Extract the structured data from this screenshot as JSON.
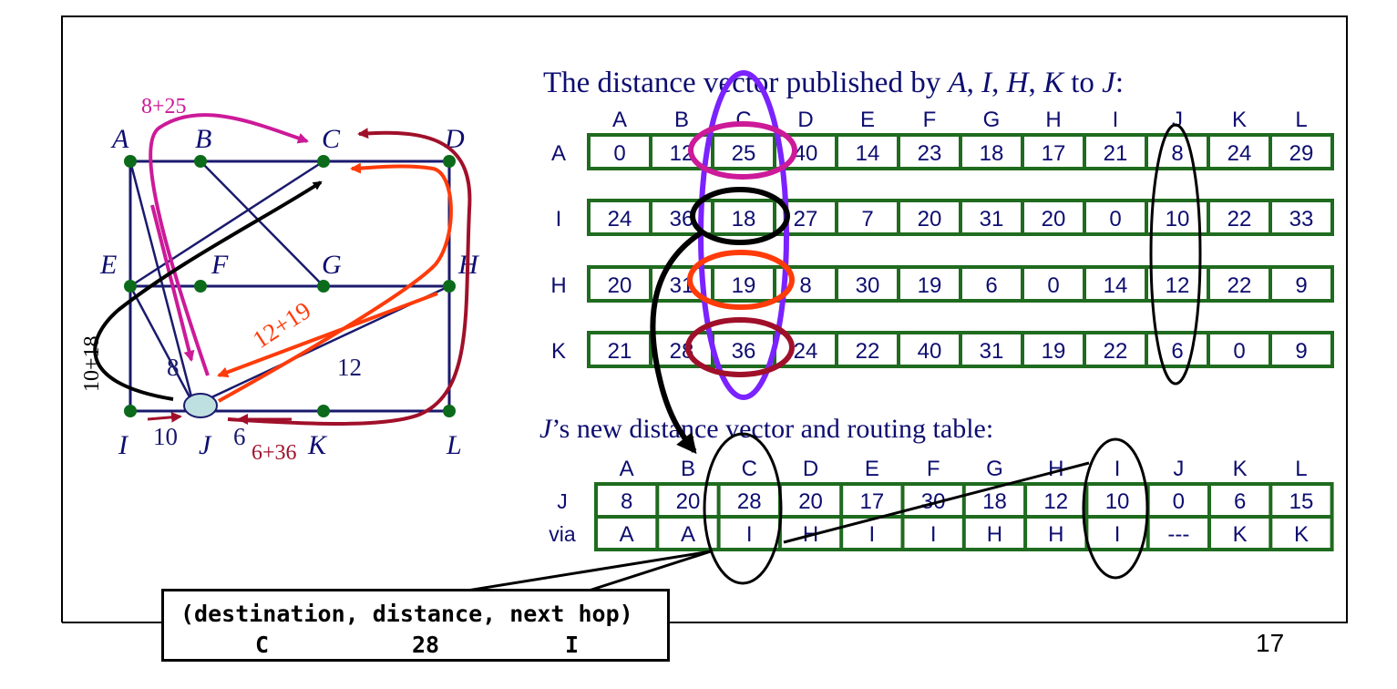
{
  "graph": {
    "nodes": [
      {
        "id": "A",
        "label": "A"
      },
      {
        "id": "B",
        "label": "B"
      },
      {
        "id": "C",
        "label": "C"
      },
      {
        "id": "D",
        "label": "D"
      },
      {
        "id": "E",
        "label": "E"
      },
      {
        "id": "F",
        "label": "F"
      },
      {
        "id": "G",
        "label": "G"
      },
      {
        "id": "H",
        "label": "H"
      },
      {
        "id": "I",
        "label": "I"
      },
      {
        "id": "J",
        "label": "J"
      },
      {
        "id": "K",
        "label": "K"
      },
      {
        "id": "L",
        "label": "L"
      }
    ],
    "edge_labels": {
      "IJ": "10",
      "JK": "6",
      "AJ": "8",
      "JH": "12"
    },
    "path_labels": {
      "via_A": "8+25",
      "via_I": "10+18",
      "via_H": "12+19",
      "via_K": "6+36"
    }
  },
  "published": {
    "title_parts": [
      "The distance vector published by ",
      "A",
      ", ",
      "I",
      ", ",
      "H",
      ", ",
      "K",
      " to ",
      "J",
      ":"
    ],
    "columns": [
      "A",
      "B",
      "C",
      "D",
      "E",
      "F",
      "G",
      "H",
      "I",
      "J",
      "K",
      "L"
    ],
    "rows": [
      {
        "label": "A",
        "values": [
          "0",
          "12",
          "25",
          "40",
          "14",
          "23",
          "18",
          "17",
          "21",
          "8",
          "24",
          "29"
        ]
      },
      {
        "label": "I",
        "values": [
          "24",
          "36",
          "18",
          "27",
          "7",
          "20",
          "31",
          "20",
          "0",
          "10",
          "22",
          "33"
        ]
      },
      {
        "label": "H",
        "values": [
          "20",
          "31",
          "19",
          "8",
          "30",
          "19",
          "6",
          "0",
          "14",
          "12",
          "22",
          "9"
        ]
      },
      {
        "label": "K",
        "values": [
          "21",
          "28",
          "36",
          "24",
          "22",
          "40",
          "31",
          "19",
          "22",
          "6",
          "0",
          "9"
        ]
      }
    ]
  },
  "new_vector": {
    "title_parts": [
      "J",
      "’s new distance vector and routing table:"
    ],
    "columns": [
      "A",
      "B",
      "C",
      "D",
      "E",
      "F",
      "G",
      "H",
      "I",
      "J",
      "K",
      "L"
    ],
    "rows": [
      {
        "label": "J",
        "values": [
          "8",
          "20",
          "28",
          "20",
          "17",
          "30",
          "18",
          "12",
          "10",
          "0",
          "6",
          "15"
        ]
      },
      {
        "label": "via",
        "values": [
          "A",
          "A",
          "I",
          "H",
          "I",
          "I",
          "H",
          "H",
          "I",
          "---",
          "K",
          "K"
        ]
      }
    ]
  },
  "callout": {
    "header": "(destination, distance, next hop)",
    "destination": "C",
    "distance": "28",
    "next_hop": "I"
  },
  "page_number": "17",
  "colors": {
    "edge": "#1a1a6e",
    "node": "#0b6b1a",
    "table_border": "#1f6b1f",
    "text_blue": "#0d0d70",
    "magenta": "#cc1a99",
    "red_orange": "#ff3b0a",
    "dark_red": "#a0102a",
    "purple": "#7a22ff",
    "black": "#000000"
  }
}
